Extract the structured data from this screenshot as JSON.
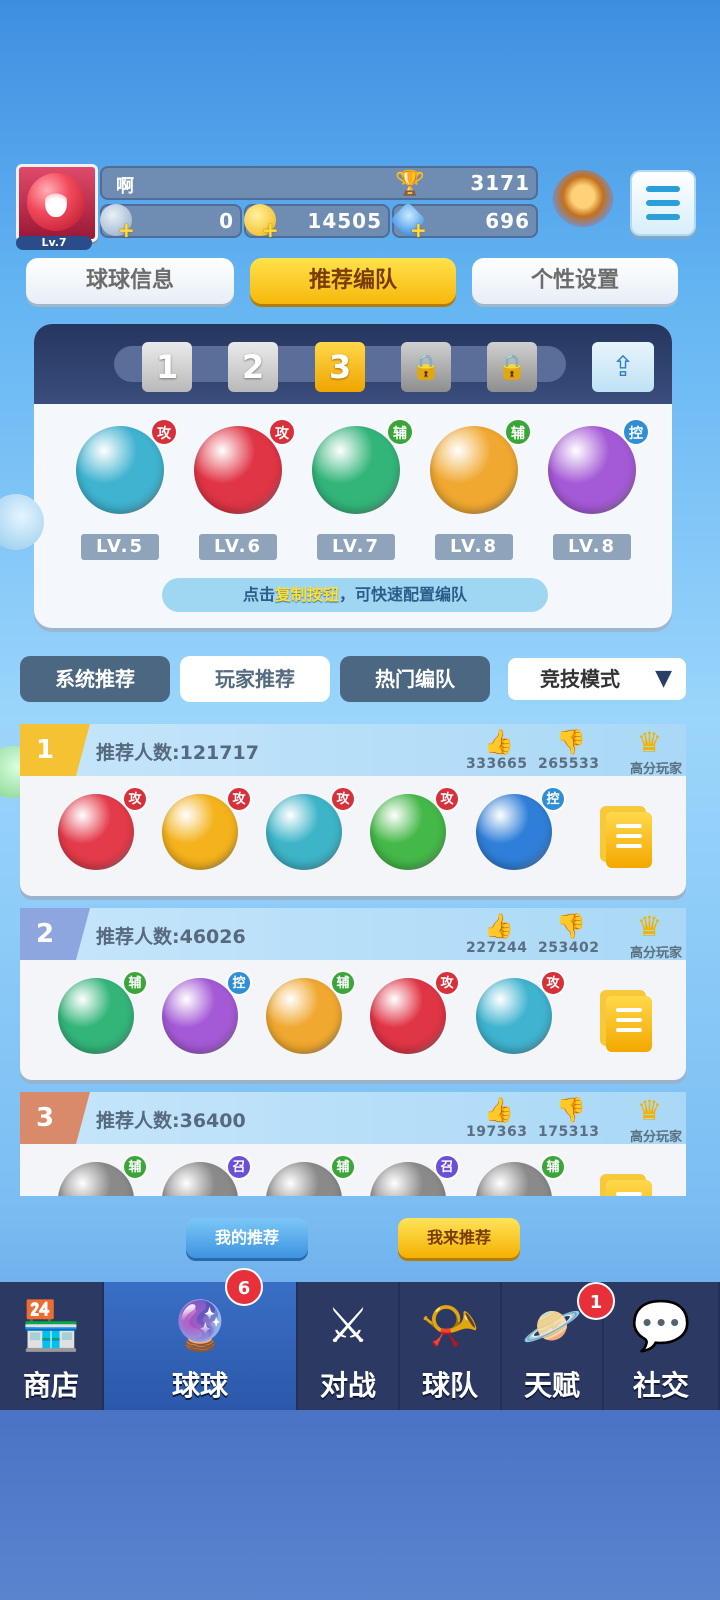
{
  "profile": {
    "name": "啊",
    "level": "Lv.7",
    "trophies": "3171",
    "stars": "0",
    "coins": "14505",
    "gems": "696"
  },
  "tabs": [
    "球球信息",
    "推荐编队",
    "个性设置"
  ],
  "team": {
    "slots": [
      "1",
      "2",
      "3"
    ],
    "selected_slot": "3",
    "balls": [
      {
        "icon": "wind-ball-icon",
        "role": "攻",
        "level": "LV.5",
        "color": "#3fb3cf"
      },
      {
        "icon": "lightning-red-ball-icon",
        "role": "攻",
        "level": "LV.6",
        "color": "#e03545"
      },
      {
        "icon": "sp-ball-icon",
        "role": "辅",
        "level": "LV.7",
        "color": "#33b57a"
      },
      {
        "icon": "rainbow-face-ball-icon",
        "role": "辅",
        "level": "LV.8",
        "color": "#f0a830"
      },
      {
        "icon": "cloud-purple-ball-icon",
        "role": "控",
        "level": "LV.8",
        "color": "#a45ad6"
      }
    ],
    "tip_prefix": "点击",
    "tip_highlight": "复制按钮",
    "tip_suffix": "，可快速配置编队"
  },
  "filters": [
    "系统推荐",
    "玩家推荐",
    "热门编队"
  ],
  "mode": "竞技模式",
  "recommendations": [
    {
      "rank": "1",
      "rank_color": "#f5c233",
      "count_label": "推荐人数:121717",
      "likes": "333665",
      "dislikes": "265533",
      "high_score_label": "高分玩家",
      "balls": [
        {
          "icon": "fire-ball-icon",
          "role": "攻",
          "color": "#e33b4a"
        },
        {
          "icon": "lightning-yellow-ball-icon",
          "role": "攻",
          "color": "#f4b21c"
        },
        {
          "icon": "wave-ball-icon",
          "role": "攻",
          "color": "#3db4c8"
        },
        {
          "icon": "poison-skull-ball-icon",
          "role": "攻",
          "color": "#44b848"
        },
        {
          "icon": "ice-ball-icon",
          "role": "控",
          "color": "#2f7fd8"
        }
      ]
    },
    {
      "rank": "2",
      "rank_color": "#8ea6e0",
      "count_label": "推荐人数:46026",
      "likes": "227244",
      "dislikes": "253402",
      "high_score_label": "高分玩家",
      "balls": [
        {
          "icon": "sp-ball-icon",
          "role": "辅",
          "color": "#33b57a"
        },
        {
          "icon": "cloud-purple-ball-icon",
          "role": "控",
          "color": "#a45ad6"
        },
        {
          "icon": "rainbow-face-ball-icon",
          "role": "辅",
          "color": "#f0a830"
        },
        {
          "icon": "lightning-red-ball-icon",
          "role": "攻",
          "color": "#e03545"
        },
        {
          "icon": "wind-ball-icon",
          "role": "攻",
          "color": "#3fb3cf"
        }
      ]
    },
    {
      "rank": "3",
      "rank_color": "#d98a6a",
      "count_label": "推荐人数:36400",
      "likes": "197363",
      "dislikes": "175313",
      "high_score_label": "高分玩家",
      "balls": [
        {
          "icon": "locked-ball-icon",
          "role": "辅",
          "color": "#8a8a8a"
        },
        {
          "icon": "locked-ball-icon",
          "role": "召",
          "color": "#8a8a8a"
        },
        {
          "icon": "locked-ball-icon",
          "role": "辅",
          "color": "#8a8a8a"
        },
        {
          "icon": "locked-ball-icon",
          "role": "召",
          "color": "#8a8a8a"
        },
        {
          "icon": "locked-ball-icon",
          "role": "辅",
          "color": "#8a8a8a"
        }
      ]
    }
  ],
  "buttons": {
    "my_recommend": "我的推荐",
    "i_recommend": "我来推荐"
  },
  "nav": [
    {
      "label": "商店",
      "icon": "shop-icon",
      "badge": ""
    },
    {
      "label": "球球",
      "icon": "balls-icon",
      "badge": "6"
    },
    {
      "label": "对战",
      "icon": "crossed-swords-icon",
      "badge": ""
    },
    {
      "label": "球队",
      "icon": "whistle-icon",
      "badge": ""
    },
    {
      "label": "天赋",
      "icon": "planet-icon",
      "badge": "1"
    },
    {
      "label": "社交",
      "icon": "chat-heart-icon",
      "badge": ""
    }
  ]
}
